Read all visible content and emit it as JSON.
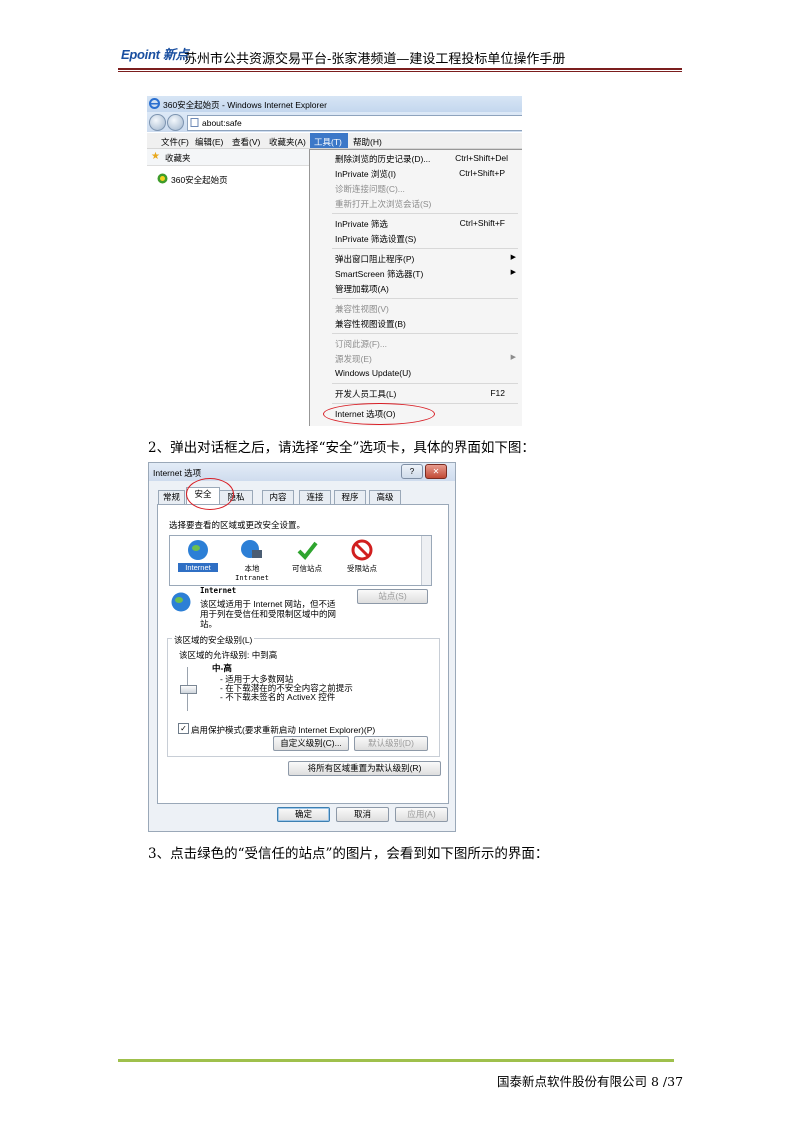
{
  "header": {
    "logo_text": "Epoint 新点",
    "title": "苏州市公共资源交易平台-张家港频道—建设工程投标单位操作手册"
  },
  "ie_screenshot": {
    "window_title": "360安全起始页 - Windows Internet Explorer",
    "address": "about:safe",
    "menu": [
      "文件(F)",
      "编辑(E)",
      "查看(V)",
      "收藏夹(A)",
      "工具(T)",
      "帮助(H)"
    ],
    "favorites_label": "收藏夹",
    "tab_label": "360安全起始页",
    "tools_menu": [
      {
        "label": "删除浏览的历史记录(D)...",
        "shortcut": "Ctrl+Shift+Del",
        "disabled": false,
        "submenu": false
      },
      {
        "label": "InPrivate 浏览(I)",
        "shortcut": "Ctrl+Shift+P",
        "disabled": false,
        "submenu": false
      },
      {
        "label": "诊断连接问题(C)...",
        "shortcut": "",
        "disabled": true,
        "submenu": false
      },
      {
        "label": "重新打开上次浏览会话(S)",
        "shortcut": "",
        "disabled": true,
        "submenu": false
      },
      {
        "label": "InPrivate 筛选",
        "shortcut": "Ctrl+Shift+F",
        "disabled": false,
        "submenu": false
      },
      {
        "label": "InPrivate 筛选设置(S)",
        "shortcut": "",
        "disabled": false,
        "submenu": false
      },
      {
        "label": "弹出窗口阻止程序(P)",
        "shortcut": "",
        "disabled": false,
        "submenu": true
      },
      {
        "label": "SmartScreen 筛选器(T)",
        "shortcut": "",
        "disabled": false,
        "submenu": true
      },
      {
        "label": "管理加载项(A)",
        "shortcut": "",
        "disabled": false,
        "submenu": false
      },
      {
        "label": "兼容性视图(V)",
        "shortcut": "",
        "disabled": true,
        "submenu": false
      },
      {
        "label": "兼容性视图设置(B)",
        "shortcut": "",
        "disabled": false,
        "submenu": false
      },
      {
        "label": "订阅此源(F)...",
        "shortcut": "",
        "disabled": true,
        "submenu": false
      },
      {
        "label": "源发现(E)",
        "shortcut": "",
        "disabled": true,
        "submenu": true
      },
      {
        "label": "Windows Update(U)",
        "shortcut": "",
        "disabled": false,
        "submenu": false
      },
      {
        "label": "开发人员工具(L)",
        "shortcut": "F12",
        "disabled": false,
        "submenu": false
      },
      {
        "label": "Internet 选项(O)",
        "shortcut": "",
        "disabled": false,
        "submenu": false
      }
    ]
  },
  "para2": "2、弹出对话框之后，请选择“安全”选项卡，具体的界面如下图：",
  "options_dialog": {
    "title": "Internet 选项",
    "tabs": [
      "常规",
      "安全",
      "隐私",
      "内容",
      "连接",
      "程序",
      "高级"
    ],
    "instruction": "选择要查看的区域或更改安全设置。",
    "zones": [
      {
        "label": "Internet",
        "sub": ""
      },
      {
        "label": "本地",
        "sub": "Intranet"
      },
      {
        "label": "可信站点",
        "sub": ""
      },
      {
        "label": "受限站点",
        "sub": ""
      }
    ],
    "zone_name": "Internet",
    "zone_desc": "该区域适用于 Internet 网站，但不适用于列在受信任和受限制区域中的网站。",
    "sites_button": "站点(S)",
    "security_level_group": "该区域的安全级别(L)",
    "allowed_levels": "该区域的允许级别: 中到高",
    "level_name": "中-高",
    "level_bullets": [
      "- 适用于大多数网站",
      "- 在下载潜在的不安全内容之前提示",
      "- 不下载未签名的 ActiveX 控件"
    ],
    "protected_mode": "启用保护模式(要求重新启动 Internet Explorer)(P)",
    "custom_level_button": "自定义级别(C)...",
    "default_level_button": "默认级别(D)",
    "reset_all_button": "将所有区域重置为默认级别(R)",
    "ok_button": "确定",
    "cancel_button": "取消",
    "apply_button": "应用(A)"
  },
  "para3": "3、点击绿色的“受信任的站点”的图片，会看到如下图所示的界面：",
  "footer": {
    "text": "国泰新点软件股份有限公司 8 /37"
  },
  "colors": {
    "header_rule": "#7b1e1e",
    "footer_rule": "#9fc04c",
    "highlight_oval": "#d81f26",
    "menu_active": "#3c78c8"
  }
}
